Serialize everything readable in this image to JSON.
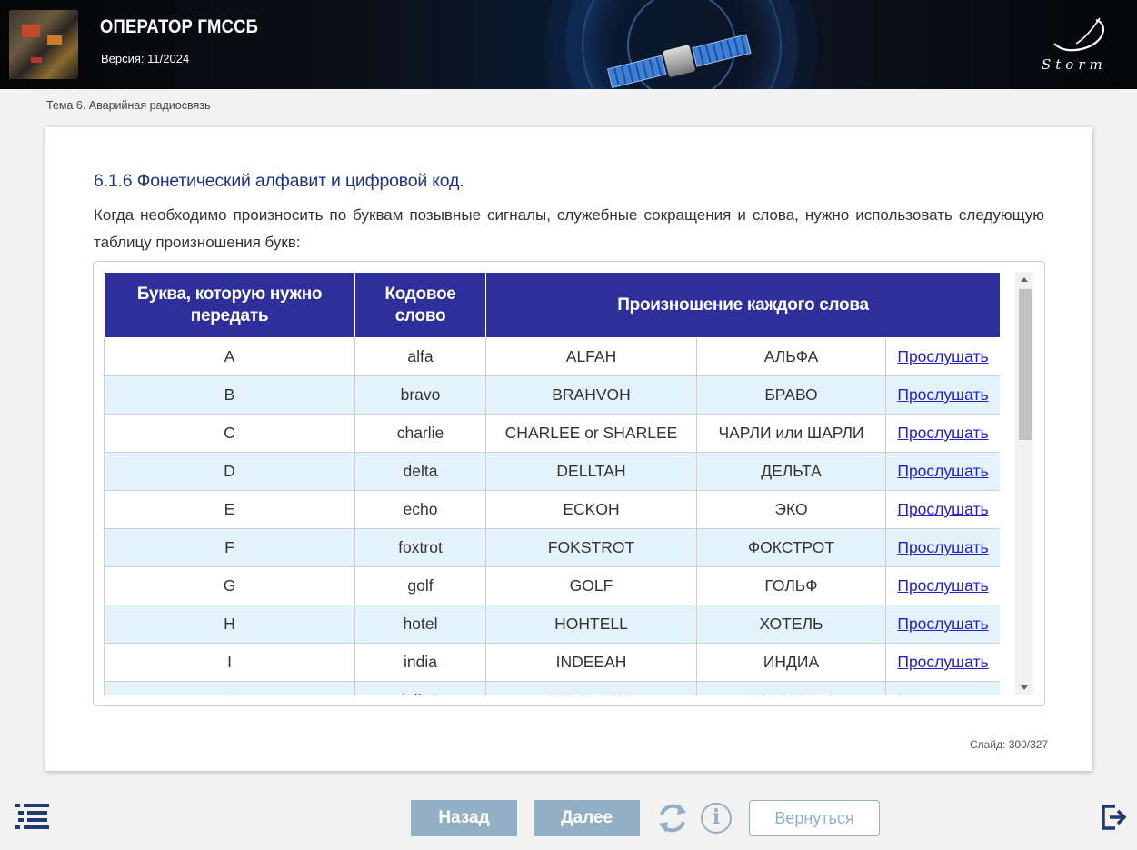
{
  "header": {
    "title": "ОПЕРАТОР ГМССБ",
    "version": "Версия: 11/2024",
    "logo_text": "Storm"
  },
  "breadcrumb": "Тема 6. Аварийная радиосвязь",
  "content": {
    "heading": "6.1.6 Фонетический алфавит и цифровой код.",
    "intro": "Когда необходимо произносить по буквам позывные сигналы, служебные сокращения и слова, нужно использовать следующую таблицу произношения букв:"
  },
  "table": {
    "headers": {
      "letter": "Буква, которую нужно передать",
      "code": "Кодовое слово",
      "pronunciation": "Произношение каждого слова"
    },
    "rows": [
      {
        "letter": "A",
        "code": "alfa",
        "latin": "ALFAH",
        "cyrillic": "АЛЬФА",
        "listen": "Прослушать"
      },
      {
        "letter": "B",
        "code": "bravo",
        "latin": "BRAHVOH",
        "cyrillic": "БРАВО",
        "listen": "Прослушать"
      },
      {
        "letter": "C",
        "code": "charlie",
        "latin": "CHARLEE or SHARLEE",
        "cyrillic": "ЧАРЛИ или ШАРЛИ",
        "listen": "Прослушать"
      },
      {
        "letter": "D",
        "code": "delta",
        "latin": "DELLTAH",
        "cyrillic": "ДЕЛЬТА",
        "listen": "Прослушать"
      },
      {
        "letter": "E",
        "code": "echo",
        "latin": "ECKOH",
        "cyrillic": "ЭКО",
        "listen": "Прослушать"
      },
      {
        "letter": "F",
        "code": "foxtrot",
        "latin": "FOKSTROT",
        "cyrillic": "ФОКСТРОТ",
        "listen": "Прослушать"
      },
      {
        "letter": "G",
        "code": "golf",
        "latin": "GOLF",
        "cyrillic": "ГОЛЬФ",
        "listen": "Прослушать"
      },
      {
        "letter": "H",
        "code": "hotel",
        "latin": "HOHTELL",
        "cyrillic": "ХОТЕЛЬ",
        "listen": "Прослушать"
      },
      {
        "letter": "I",
        "code": "india",
        "latin": "INDEEAH",
        "cyrillic": "ИНДИА",
        "listen": "Прослушать"
      },
      {
        "letter": "J",
        "code": "juliett",
        "latin": "JEWLEEETT",
        "cyrillic": "ЖЮЛИЕТТ",
        "listen": "Прослушать"
      }
    ]
  },
  "slide": {
    "label": "Слайд:",
    "current": "300",
    "separator": "/",
    "total": "327"
  },
  "footer": {
    "back_label": "Назад",
    "next_label": "Далее",
    "info_glyph": "i",
    "return_label": "Вернуться"
  }
}
